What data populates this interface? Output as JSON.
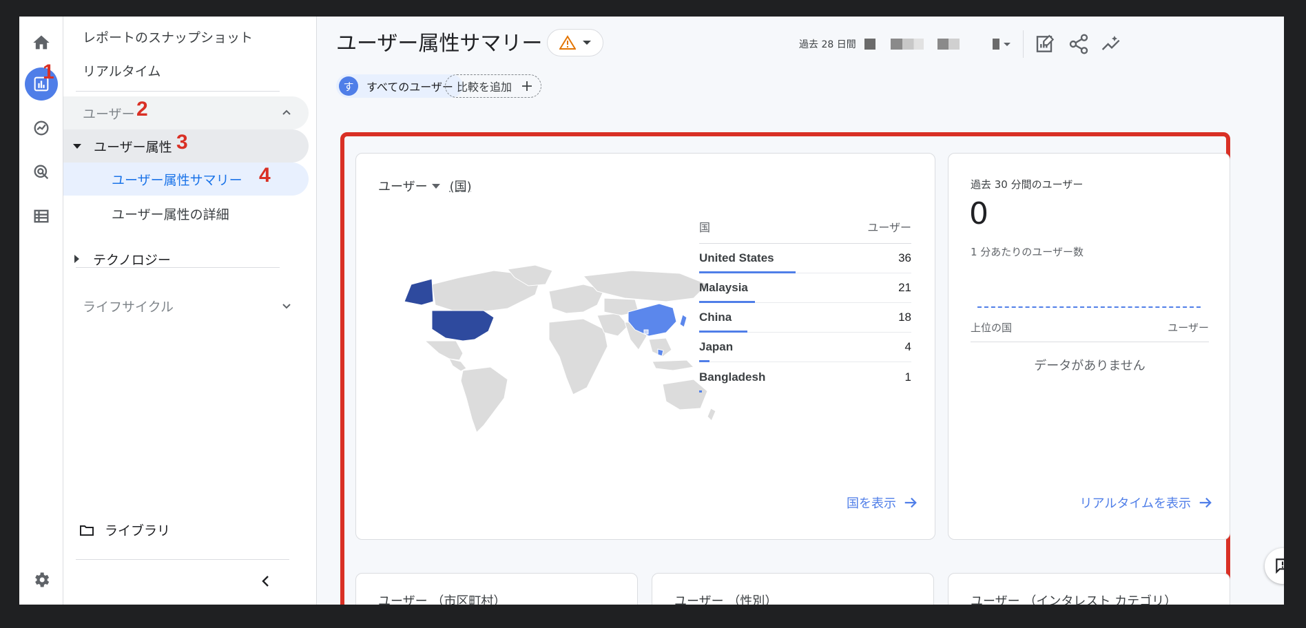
{
  "sidebar": {
    "snapshot": "レポートのスナップショット",
    "realtime": "リアルタイム",
    "users_section": "ユーザー",
    "user_attributes": "ユーザー属性",
    "attr_summary": "ユーザー属性サマリー",
    "attr_details": "ユーザー属性の詳細",
    "technology": "テクノロジー",
    "lifecycle": "ライフサイクル",
    "library": "ライブラリ"
  },
  "annotations": [
    "1",
    "2",
    "3",
    "4"
  ],
  "header": {
    "title": "ユーザー属性サマリー",
    "date_range": "過去 28 日間"
  },
  "chips": {
    "all_users_initial": "す",
    "all_users": "すべてのユーザー",
    "add_comparison": "比較を追加"
  },
  "country_card": {
    "metric": "ユーザー",
    "dimension": "(国)",
    "col_country": "国",
    "col_users": "ユーザー",
    "rows": [
      {
        "country": "United States",
        "users": "36",
        "share": 1.0
      },
      {
        "country": "Malaysia",
        "users": "21",
        "share": 0.58
      },
      {
        "country": "China",
        "users": "18",
        "share": 0.5
      },
      {
        "country": "Japan",
        "users": "4",
        "share": 0.11
      },
      {
        "country": "Bangladesh",
        "users": "1",
        "share": 0.03
      }
    ],
    "view_link": "国を表示"
  },
  "realtime_card": {
    "title": "過去 30 分間のユーザー",
    "value": "0",
    "per_minute": "1 分あたりのユーザー数",
    "col_country": "上位の国",
    "col_users": "ユーザー",
    "empty": "データがありません",
    "view_link": "リアルタイムを表示"
  },
  "bottom_cards": [
    "ユーザー （市区町村）",
    "ユーザー （性別）",
    "ユーザー （インタレスト カテゴリ）"
  ],
  "colors": {
    "accent": "#4f7ee8",
    "highlight": "#d93025",
    "map_dark": "#2e4a9e",
    "map_light": "#5b87ec",
    "map_land": "#dcdcdc"
  }
}
